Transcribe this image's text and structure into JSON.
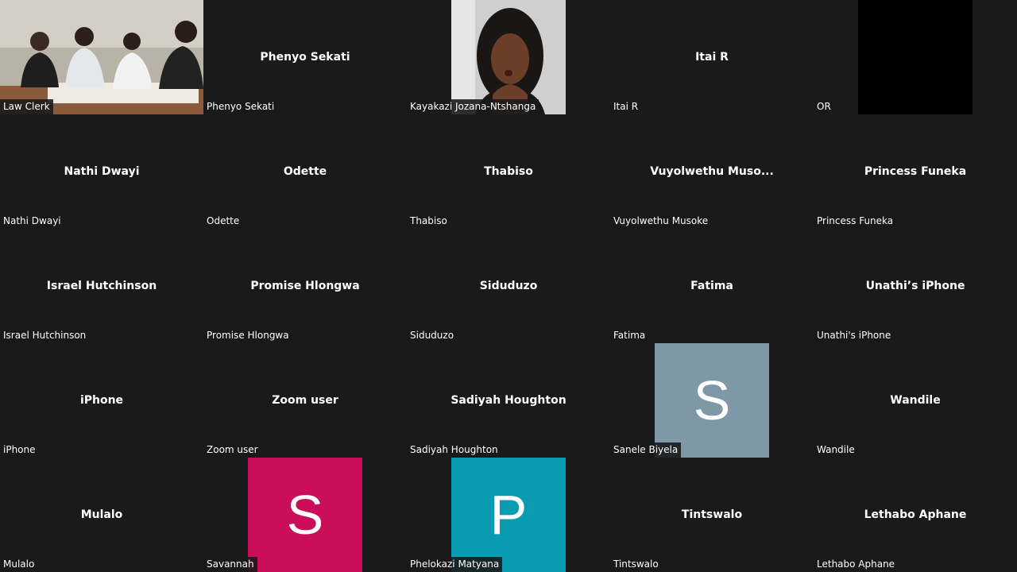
{
  "colors": {
    "background": "#1a1a1a",
    "text": "#ffffff",
    "avatar_sanele": "#7f98a8",
    "avatar_savannah": "#ca0e5a",
    "avatar_phelokazi": "#099bb1"
  },
  "participants": [
    {
      "tag": "Law Clerk",
      "tile": "video"
    },
    {
      "center": "Phenyo Sekati",
      "tag": "Phenyo Sekati"
    },
    {
      "tag": "Kayakazi Jozana-Ntshanga",
      "tile": "photo"
    },
    {
      "center": "Itai R",
      "tag": "Itai R"
    },
    {
      "tag": "OR",
      "tile": "black"
    },
    {
      "center": "Nathi Dwayi",
      "tag": "Nathi Dwayi"
    },
    {
      "center": "Odette",
      "tag": "Odette"
    },
    {
      "center": "Thabiso",
      "tag": "Thabiso"
    },
    {
      "center": "Vuyolwethu  Muso...",
      "tag": "Vuyolwethu Musoke"
    },
    {
      "center": "Princess Funeka",
      "tag": "Princess Funeka"
    },
    {
      "center": "Israel Hutchinson",
      "tag": "Israel Hutchinson"
    },
    {
      "center": "Promise Hlongwa",
      "tag": "Promise Hlongwa"
    },
    {
      "center": "Siduduzo",
      "tag": "Siduduzo"
    },
    {
      "center": "Fatima",
      "tag": "Fatima"
    },
    {
      "center": "Unathi’s iPhone",
      "tag": "Unathi's iPhone"
    },
    {
      "center": "iPhone",
      "tag": "iPhone"
    },
    {
      "center": "Zoom user",
      "tag": "Zoom user"
    },
    {
      "center": "Sadiyah Houghton",
      "tag": "Sadiyah Houghton"
    },
    {
      "tag": "Sanele Biyela",
      "tile": "avatar",
      "letter": "S",
      "color": "#7f98a8"
    },
    {
      "center": "Wandile",
      "tag": "Wandile"
    },
    {
      "center": "Mulalo",
      "tag": "Mulalo"
    },
    {
      "tag": "Savannah",
      "tile": "avatar",
      "letter": "S",
      "color": "#ca0e5a"
    },
    {
      "tag": "Phelokazi Matyana",
      "tile": "avatar",
      "letter": "P",
      "color": "#099bb1"
    },
    {
      "center": "Tintswalo",
      "tag": "Tintswalo"
    },
    {
      "center": "Lethabo Aphane",
      "tag": "Lethabo Aphane"
    }
  ]
}
